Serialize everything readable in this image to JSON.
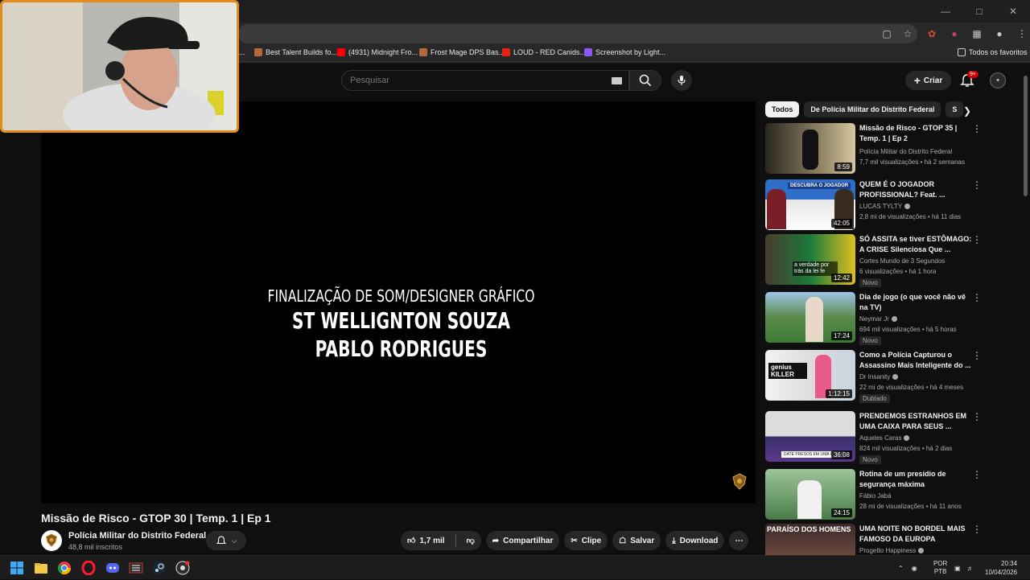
{
  "search": {
    "placeholder": "Pesquisar"
  },
  "header": {
    "create_label": "Criar",
    "notifications_badge": "9+"
  },
  "bookmarks": [
    "...",
    "Best Talent Builds fo...",
    "(4931) Midnight Fro...",
    "Frost Mage DPS Bas...",
    "LOUD - RED Canids...",
    "Screenshot by Light...",
    "Todos os favoritos"
  ],
  "player": {
    "credit_line_1": "FINALIZAÇÃO DE SOM/DESIGNER GRÁFICO",
    "credit_line_2": "ST WELLIGNTON SOUZA",
    "credit_line_3": "PABLO RODRIGUES"
  },
  "video": {
    "title": "Missão de Risco - GTOP 30 | Temp. 1 | Ep 1",
    "channel_name": "Polícia Militar do Distrito Federal",
    "subscribers": "48,8 mil inscritos",
    "likes": "1,7 mil",
    "share_label": "Compartilhar",
    "clip_label": "Clipe",
    "save_label": "Salvar",
    "download_label": "Download"
  },
  "chips": [
    "Todos",
    "De Polícia Militar do Distrito Federal",
    "S"
  ],
  "recommendations": [
    {
      "title_1": "Missão de Risco - GTOP 35 |",
      "title_2": "Temp. 1 | Ep 2",
      "channel": "Polícia Militar do Distrito Federal",
      "meta": "7,7 mil visualizações • há 2 semanas",
      "duration": "8:59",
      "badge": ""
    },
    {
      "title_1": "QUEM É O JOGADOR",
      "title_2": "PROFISSIONAL? Feat. ...",
      "channel": "LUCAS TYLTY",
      "meta": "2,8 mi de visualizações • há 11 dias",
      "duration": "42:05",
      "badge": ""
    },
    {
      "title_1": "SÓ ASSITA se tiver ESTÔMAGO:",
      "title_2": "A CRISE Silenciosa Que ...",
      "channel": "Cortes Mundo de 3 Segundos",
      "meta": "6 visualizações • há 1 hora",
      "duration": "12:42",
      "badge": "Novo"
    },
    {
      "title_1": "Dia de jogo (o que você não vê",
      "title_2": "na TV)",
      "channel": "Neymar Jr",
      "meta": "694 mil visualizações • há 5 horas",
      "duration": "17:24",
      "badge": "Novo"
    },
    {
      "title_1": "Como a Polícia Capturou o",
      "title_2": "Assassino Mais Inteligente do ...",
      "channel": "Dr Insanity",
      "meta": "22 mi de visualizações • há 4 meses",
      "duration": "1:12:15",
      "badge": "Dublado"
    },
    {
      "title_1": "PRENDEMOS ESTRANHOS EM",
      "title_2": "UMA CAIXA PARA SEUS ...",
      "channel": "Aqueles Caras",
      "meta": "824 mil visualizações • há 2 dias",
      "duration": "36:08",
      "badge": "Novo"
    },
    {
      "title_1": "Rotina de um presídio de",
      "title_2": "segurança máxima",
      "channel": "Fábio Jabá",
      "meta": "28 mi de visualizações • há 11 anos",
      "duration": "24:15",
      "badge": ""
    },
    {
      "title_1": "UMA NOITE NO BORDEL MAIS",
      "title_2": "FAMOSO DA EUROPA",
      "channel": "Progetto Happiness",
      "meta": "",
      "duration": "",
      "badge": ""
    }
  ],
  "thumb_texts": {
    "t2": "DESCUBRA O JOGADOR",
    "t3": "a verdade por trás da lei fe",
    "t5": "genius KILLER",
    "t6": "DATE PRESOS EM UMA CAIXA",
    "t8": "PARAÍSO DOS HOMENS"
  },
  "taskbar": {
    "lang_1": "POR",
    "lang_2": "PTB",
    "time": "20:34",
    "date": "10/04/2026"
  },
  "colors": {
    "accent": "#cc0000",
    "webcam_border": "#e38b1c",
    "background": "#0f0f0f"
  }
}
